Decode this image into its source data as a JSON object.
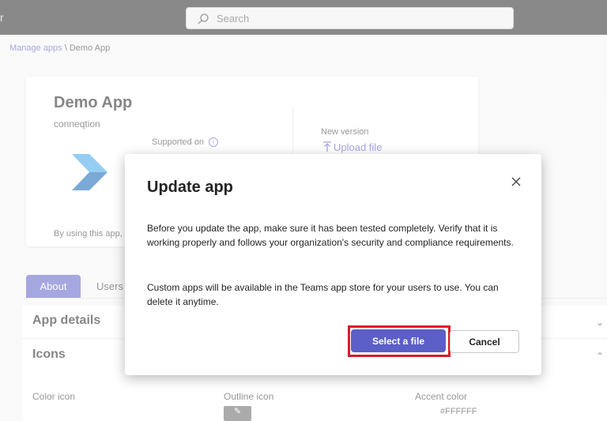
{
  "topbar": {
    "app_letter": "r",
    "search_placeholder": "Search"
  },
  "breadcrumb": {
    "link": "Manage apps",
    "separator": "\\",
    "current": "Demo App"
  },
  "app_card": {
    "name": "Demo App",
    "developer": "conneqtion",
    "supported_on": "Supported on",
    "new_version": "New version",
    "upload_file": "Upload file",
    "terms_text": "By using this app, y"
  },
  "tabs": {
    "about": "About",
    "users": "Users a"
  },
  "sections": {
    "app_details": "App details",
    "icons": "Icons"
  },
  "icons_section": {
    "color_icon": "Color icon",
    "outline_icon": "Outline icon",
    "accent_color": "Accent color",
    "accent_value": "#FFFFFF"
  },
  "dialog": {
    "title": "Update app",
    "paragraph1": "Before you update the app, make sure it has been tested completely. Verify that it is working properly and follows your organization's security and compliance requirements.",
    "paragraph2": "Custom apps will be available in the Teams app store for your users to use. You can delete it anytime.",
    "select_button": "Select a file",
    "cancel_button": "Cancel"
  },
  "colors": {
    "accent": "#5b5fc7",
    "highlight": "#d81b2a",
    "topbar": "#292929"
  },
  "icons": {
    "search": "search-icon",
    "info": "info-icon",
    "upload": "upload-arrow-icon",
    "close": "close-icon",
    "chevron": "chevron-icon",
    "logo": "app-logo"
  }
}
